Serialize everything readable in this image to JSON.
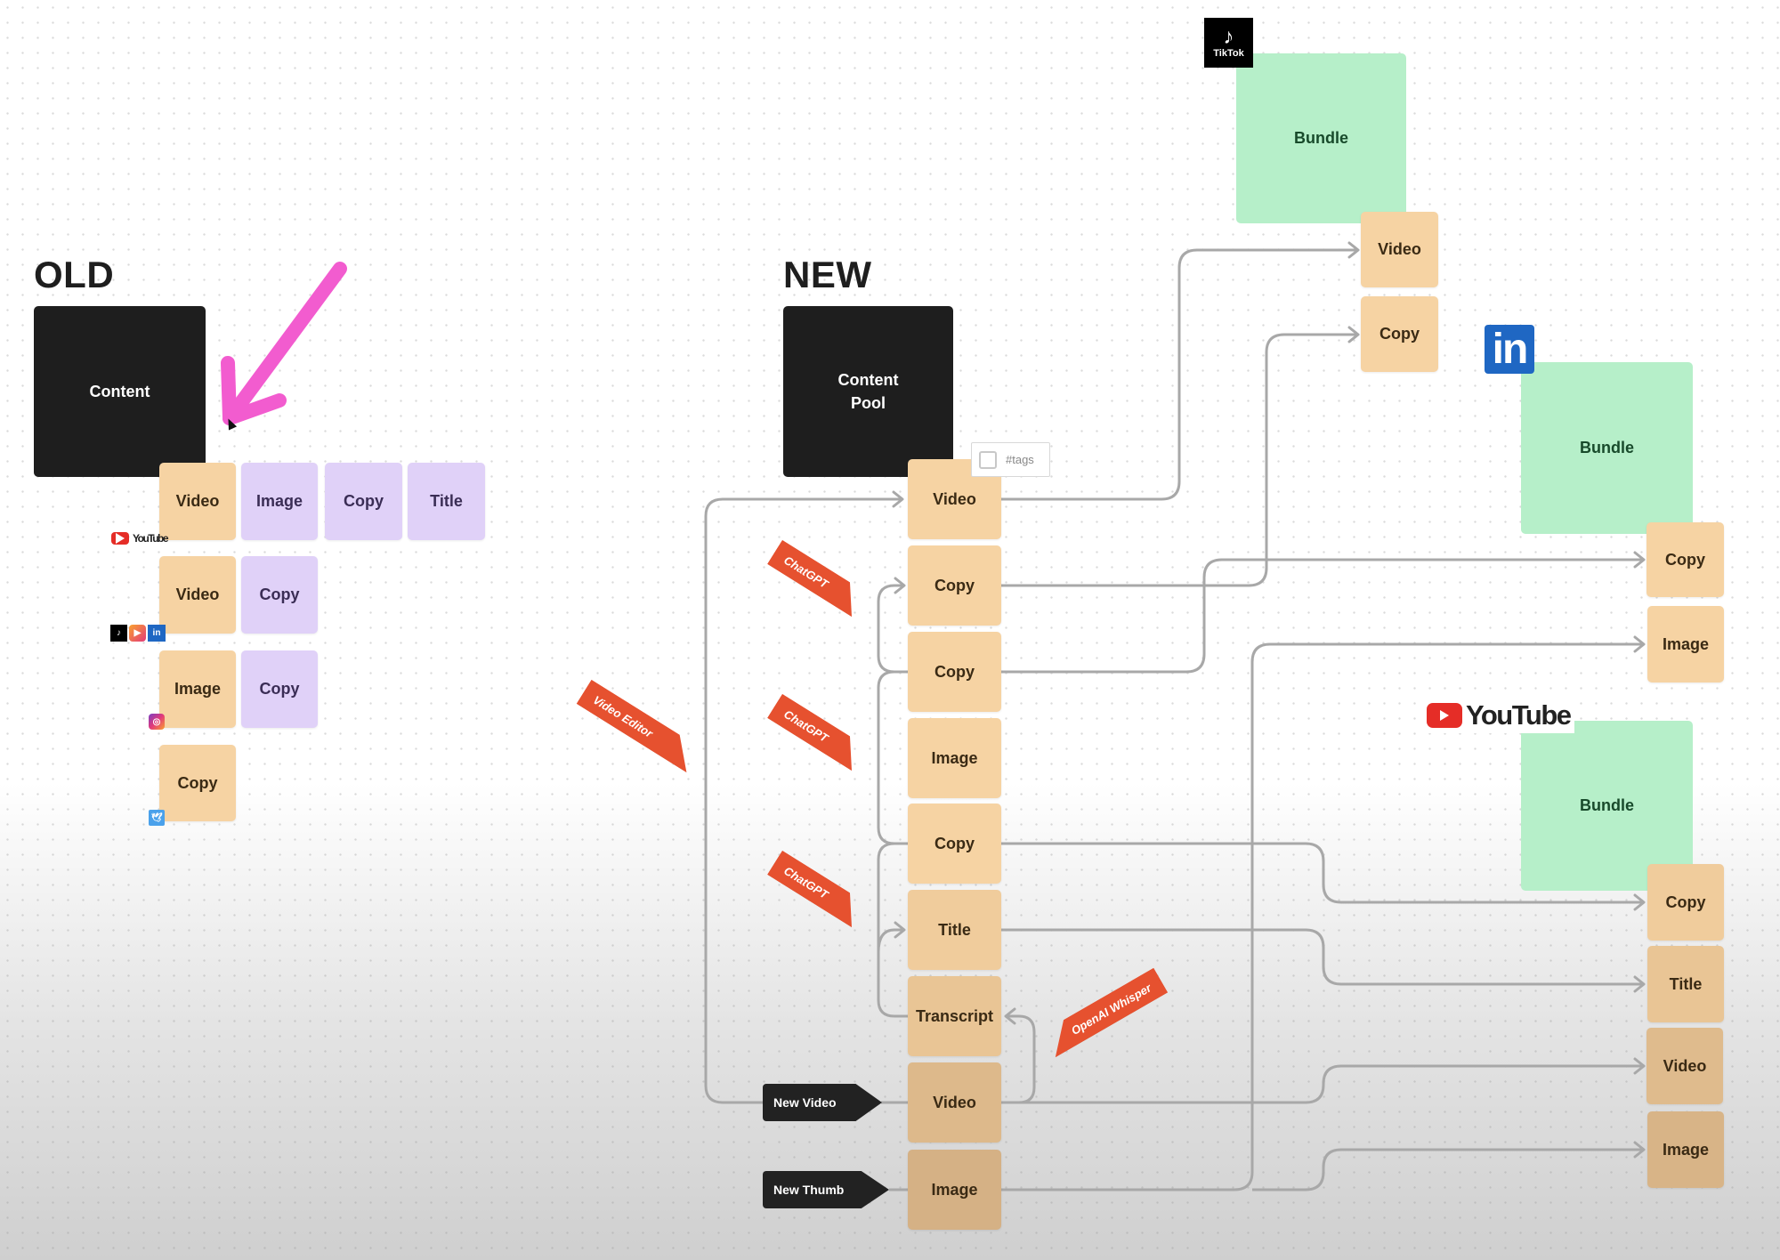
{
  "old": {
    "heading": "OLD",
    "source": "Content",
    "rows": [
      {
        "platform_icons": [
          "youtube-logo"
        ],
        "platform_label": "YouTube",
        "tiles": [
          {
            "label": "Video",
            "color": "orange"
          },
          {
            "label": "Image",
            "color": "purple"
          },
          {
            "label": "Copy",
            "color": "purple"
          },
          {
            "label": "Title",
            "color": "purple"
          }
        ]
      },
      {
        "platform_icons": [
          "tiktok-icon",
          "instagram-reels-icon",
          "linkedin-icon"
        ],
        "tiles": [
          {
            "label": "Video",
            "color": "orange"
          },
          {
            "label": "Copy",
            "color": "purple"
          }
        ]
      },
      {
        "platform_icons": [
          "instagram-icon"
        ],
        "tiles": [
          {
            "label": "Image",
            "color": "orange"
          },
          {
            "label": "Copy",
            "color": "purple"
          }
        ]
      },
      {
        "platform_icons": [
          "twitter-icon"
        ],
        "tiles": [
          {
            "label": "Copy",
            "color": "orange"
          }
        ]
      }
    ],
    "annotation": "pink-arrow"
  },
  "new": {
    "heading": "NEW",
    "source": "Content\nPool",
    "tag_chip": "#tags",
    "pool_items": [
      "Video",
      "Copy",
      "Copy",
      "Image",
      "Copy",
      "Title",
      "Transcript",
      "Video",
      "Image"
    ],
    "tools": {
      "chatgpt": "ChatGPT",
      "video_editor": "Video Editor",
      "whisper": "OpenAI Whisper",
      "new_video": "New Video",
      "new_thumb": "New Thumb"
    },
    "platforms": [
      {
        "name": "TikTok",
        "bundle": "Bundle",
        "items": [
          "Video",
          "Copy"
        ]
      },
      {
        "name": "LinkedIn",
        "logo_text": "in",
        "bundle": "Bundle",
        "items": [
          "Copy",
          "Image"
        ]
      },
      {
        "name": "YouTube",
        "bundle": "Bundle",
        "items": [
          "Copy",
          "Title",
          "Video",
          "Image"
        ]
      }
    ]
  },
  "colors": {
    "asset_orange": "#f6d3a3",
    "asset_purple": "#e0d1f8",
    "bundle_green": "#b6efc9",
    "tool_red": "#e6512f",
    "source_black": "#1e1e1e",
    "annotation_pink": "#f25ccf",
    "connector_gray": "#a8a8a8"
  }
}
